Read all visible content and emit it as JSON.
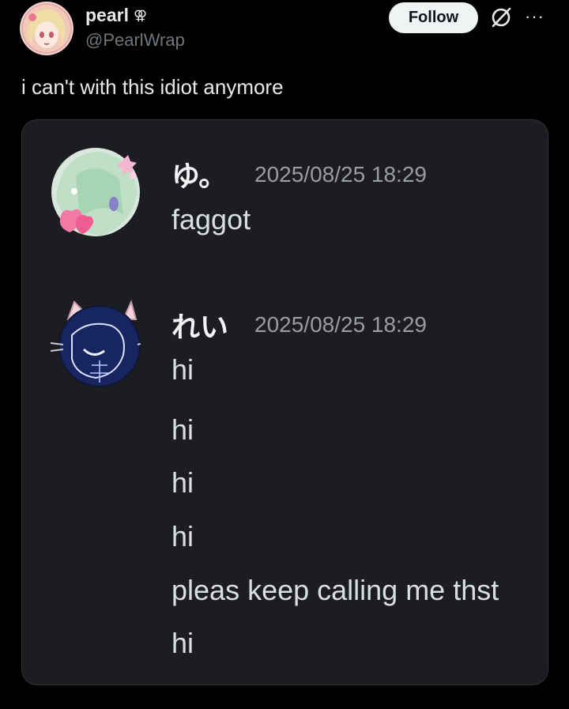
{
  "post": {
    "author": {
      "display_name": "pearl",
      "badge_symbol": "⚢",
      "handle": "@PearlWrap"
    },
    "follow_label": "Follow",
    "more_label": "···",
    "text": "i can't with this idiot anymore"
  },
  "screenshot": {
    "messages": [
      {
        "username": "ゆ。",
        "timestamp": "2025/08/25 18:29",
        "lines": [
          "faggot"
        ]
      },
      {
        "username": "れい",
        "timestamp": "2025/08/25 18:29",
        "lines": [
          "hi",
          "hi",
          "hi",
          "hi",
          "pleas keep calling me thst",
          "hi"
        ]
      }
    ]
  },
  "colors": {
    "background": "#000000",
    "card_background": "#1c1d21",
    "follow_button": "#eff3f4",
    "muted_text": "#71767b"
  },
  "icons": [
    "gender-icon",
    "grok-icon",
    "more-icon"
  ]
}
